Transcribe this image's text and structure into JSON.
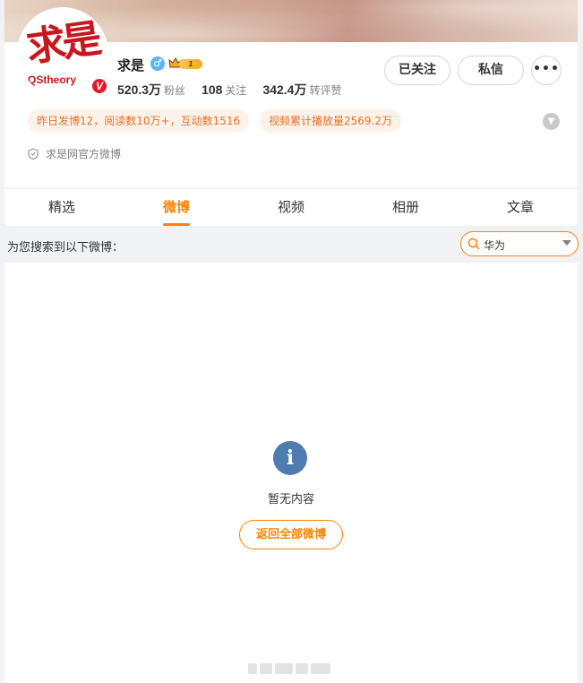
{
  "profile": {
    "name": "求是",
    "avatar_logo": "求是",
    "avatar_logo_text": "QStheory",
    "verified_badge": "V",
    "vip_level": "1",
    "stats": [
      {
        "value": "520.3万",
        "label": "粉丝"
      },
      {
        "value": "108",
        "label": "关注"
      },
      {
        "value": "342.4万",
        "label": "转评赞"
      }
    ],
    "buttons": {
      "followed": "已关注",
      "message": "私信",
      "more": "•••"
    },
    "pills": [
      "昨日发博12，阅读数10万+，互动数1516",
      "视频累计播放量2569.2万"
    ],
    "official_label": "求是网官方微博"
  },
  "tabs": [
    {
      "label": "精选",
      "active": false
    },
    {
      "label": "微博",
      "active": true
    },
    {
      "label": "视频",
      "active": false
    },
    {
      "label": "相册",
      "active": false
    },
    {
      "label": "文章",
      "active": false
    }
  ],
  "search": {
    "label": "为您搜索到以下微博：",
    "value": "华为"
  },
  "empty_state": {
    "icon": "i",
    "message": "暂无内容",
    "return_button": "返回全部微博"
  },
  "colors": {
    "accent": "#ff8200",
    "info_icon": "#4e7cae",
    "verified": "#e6162d"
  },
  "icons": [
    "gender-male-icon",
    "vip-crown-icon",
    "chevron-down-icon",
    "shield-icon",
    "search-icon",
    "dropdown-caret-icon",
    "info-icon"
  ]
}
